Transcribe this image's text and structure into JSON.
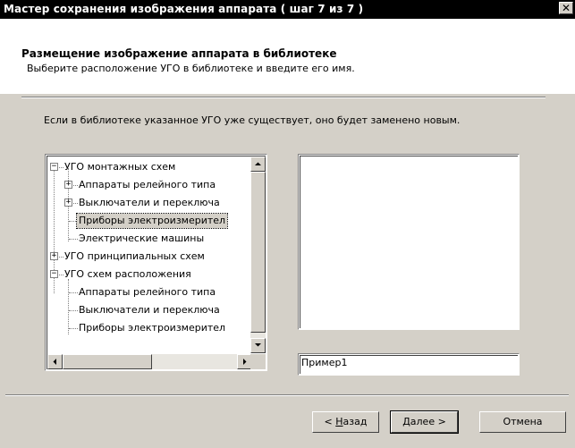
{
  "window": {
    "title": "Мастер сохранения изображения аппарата ( шаг 7 из 7 )",
    "close_glyph": "✕"
  },
  "header": {
    "title": "Размещение изображение аппарата в библиотеке",
    "subtitle": "Выберите расположение УГО в библиотеке и введите его имя."
  },
  "info_text": "Если в библиотеке указанное УГО уже существует, оно будет заменено новым.",
  "tree": {
    "items": [
      {
        "label": "УГО монтажных схем",
        "level": 0,
        "toggle": "−"
      },
      {
        "label": "Аппараты релейного типа",
        "level": 1,
        "toggle": "+"
      },
      {
        "label": "Выключатели и переключа",
        "level": 1,
        "toggle": "+"
      },
      {
        "label": "Приборы электроизмерител",
        "level": 1,
        "toggle": "",
        "selected": true
      },
      {
        "label": "Электрические машины",
        "level": 1,
        "toggle": ""
      },
      {
        "label": "УГО принципиальных схем",
        "level": 0,
        "toggle": "+"
      },
      {
        "label": "УГО схем расположения",
        "level": 0,
        "toggle": "−"
      },
      {
        "label": "Аппараты релейного типа",
        "level": 1,
        "toggle": ""
      },
      {
        "label": "Выключатели и переключа",
        "level": 1,
        "toggle": ""
      },
      {
        "label": "Приборы электроизмерител",
        "level": 1,
        "toggle": ""
      }
    ]
  },
  "name_field": {
    "value": "Пример1"
  },
  "buttons": {
    "back_prefix": "< ",
    "back_hotkey": "Н",
    "back_rest": "азад",
    "next_label": "Далее >",
    "cancel_label": "Отмена"
  },
  "colors": {
    "titlebar_bg": "#000000",
    "dialog_bg": "#d4d0c8",
    "header_bg": "#ffffff"
  }
}
